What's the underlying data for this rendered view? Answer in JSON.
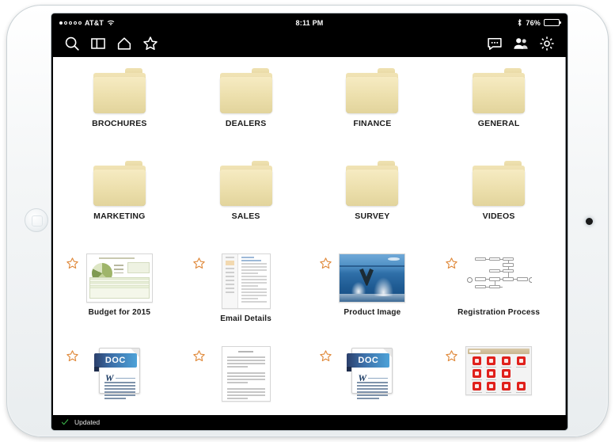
{
  "status_bar": {
    "carrier": "AT&T",
    "signal_dots_total": 5,
    "signal_dots_filled": 1,
    "wifi_icon": "wifi-icon",
    "time": "8:11 PM",
    "bluetooth_icon": "bluetooth-icon",
    "battery_percent": "76%",
    "battery_level": 76
  },
  "toolbar": {
    "left_icons": [
      {
        "name": "search-icon",
        "label": "Search"
      },
      {
        "name": "split-view-icon",
        "label": "Split View"
      },
      {
        "name": "home-icon",
        "label": "Home"
      },
      {
        "name": "favorites-star-icon",
        "label": "Favorites"
      }
    ],
    "right_icons": [
      {
        "name": "chat-bubble-icon",
        "label": "Messages"
      },
      {
        "name": "contacts-icon",
        "label": "Contacts"
      },
      {
        "name": "gear-icon",
        "label": "Settings"
      }
    ]
  },
  "grid": {
    "items": [
      {
        "label": "BROCHURES",
        "type": "folder",
        "starred": false
      },
      {
        "label": "DEALERS",
        "type": "folder",
        "starred": false
      },
      {
        "label": "FINANCE",
        "type": "folder",
        "starred": false
      },
      {
        "label": "GENERAL",
        "type": "folder",
        "starred": false
      },
      {
        "label": "MARKETING",
        "type": "folder",
        "starred": false
      },
      {
        "label": "SALES",
        "type": "folder",
        "starred": false
      },
      {
        "label": "SURVEY",
        "type": "folder",
        "starred": false
      },
      {
        "label": "VIDEOS",
        "type": "folder",
        "starred": false
      },
      {
        "label": "Budget for 2015",
        "type": "spreadsheet",
        "starred": true
      },
      {
        "label": "Email Details",
        "type": "email",
        "starred": true
      },
      {
        "label": "Product Image",
        "type": "photo",
        "starred": true
      },
      {
        "label": "Registration Process",
        "type": "flowchart",
        "starred": true
      },
      {
        "label": "",
        "type": "doc-word",
        "starred": true,
        "badge": "DOC",
        "badge_letter": "W"
      },
      {
        "label": "",
        "type": "text-doc",
        "starred": true
      },
      {
        "label": "",
        "type": "doc-word",
        "starred": true,
        "badge": "DOC",
        "badge_letter": "W"
      },
      {
        "label": "",
        "type": "app-grid",
        "starred": true
      }
    ]
  },
  "bottom_bar": {
    "status_icon": "check-icon",
    "status_text": "Updated",
    "status_color": "#3cb54a"
  },
  "colors": {
    "folder": "#ecdfac",
    "star_outline": "#e08a3c",
    "chrome": "#000000",
    "accent_blue": "#4da2d8",
    "app_red": "#e0201b"
  }
}
